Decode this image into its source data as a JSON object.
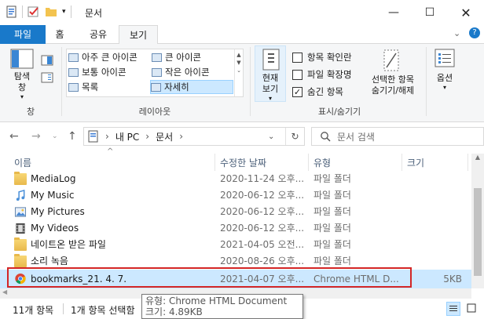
{
  "window": {
    "title": "문서"
  },
  "tabs": [
    {
      "label": "파일"
    },
    {
      "label": "홈"
    },
    {
      "label": "공유"
    },
    {
      "label": "보기"
    }
  ],
  "ribbon": {
    "nav_pane_label": "탐색\n창",
    "nav_group_label": "창",
    "layout_items": [
      {
        "label": "아주 큰 아이콘"
      },
      {
        "label": "큰 아이콘"
      },
      {
        "label": "보통 아이콘"
      },
      {
        "label": "작은 아이콘"
      },
      {
        "label": "목록"
      },
      {
        "label": "자세히"
      }
    ],
    "layout_group_label": "레이아웃",
    "current_view_label": "현재\n보기",
    "checkboxes": [
      {
        "label": "항목 확인란",
        "checked": false
      },
      {
        "label": "파일 확장명",
        "checked": false
      },
      {
        "label": "숨긴 항목",
        "checked": true
      }
    ],
    "hide_selected_label": "선택한 항목\n숨기기/해제",
    "show_hide_group_label": "표시/숨기기",
    "options_label": "옵션"
  },
  "address": {
    "path": [
      "내 PC",
      "문서"
    ],
    "search_placeholder": "문서 검색"
  },
  "columns": {
    "name": "이름",
    "date": "수정한 날짜",
    "type": "유형",
    "size": "크기"
  },
  "files": [
    {
      "name": "MediaLog",
      "date": "2020-11-24 오후...",
      "type": "파일 폴더",
      "size": "",
      "icon": "folder-icon"
    },
    {
      "name": "My Music",
      "date": "2020-06-12 오후...",
      "type": "파일 폴더",
      "size": "",
      "icon": "music-folder-icon"
    },
    {
      "name": "My Pictures",
      "date": "2020-06-12 오후...",
      "type": "파일 폴더",
      "size": "",
      "icon": "pictures-folder-icon"
    },
    {
      "name": "My Videos",
      "date": "2020-06-12 오후...",
      "type": "파일 폴더",
      "size": "",
      "icon": "videos-folder-icon"
    },
    {
      "name": "네이트온 받은 파일",
      "date": "2021-04-05 오전...",
      "type": "파일 폴더",
      "size": "",
      "icon": "folder-icon"
    },
    {
      "name": "소리 녹음",
      "date": "2020-08-26 오후...",
      "type": "파일 폴더",
      "size": "",
      "icon": "folder-icon"
    },
    {
      "name": "bookmarks_21. 4. 7.",
      "date": "2021-04-07 오후...",
      "type": "Chrome HTML D...",
      "size": "5KB",
      "icon": "chrome-icon"
    }
  ],
  "status": {
    "item_count": "11개 항목",
    "selected": "1개 항목 선택함"
  },
  "tooltip": {
    "type_line": "유형: Chrome HTML Document",
    "size_line": "크기: 4.89KB"
  }
}
